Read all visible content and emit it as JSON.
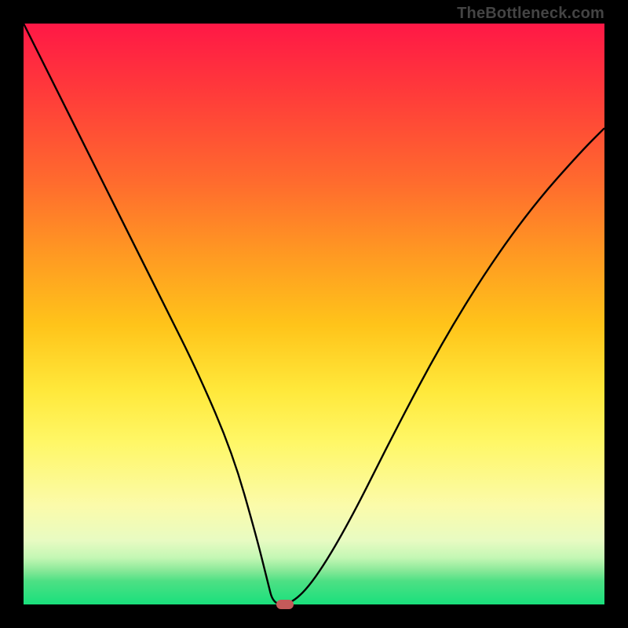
{
  "watermark": "TheBottleneck.com",
  "chart_data": {
    "type": "line",
    "title": "",
    "xlabel": "",
    "ylabel": "",
    "xlim": [
      0,
      100
    ],
    "ylim": [
      0,
      100
    ],
    "grid": false,
    "legend": false,
    "series": [
      {
        "name": "curve",
        "x": [
          0,
          6,
          12,
          18,
          24,
          30,
          36,
          40,
          42,
          43,
          46,
          50,
          56,
          64,
          72,
          80,
          88,
          96,
          100
        ],
        "y": [
          100,
          88,
          76,
          64,
          52,
          40,
          26,
          12,
          4,
          0,
          0,
          4,
          14,
          30,
          45,
          58,
          69,
          78,
          82
        ]
      }
    ],
    "marker": {
      "x": 45,
      "y": 0,
      "color": "#c45a5a"
    },
    "background_gradient": {
      "top": "#ff1846",
      "bottom": "#19e07c"
    }
  }
}
